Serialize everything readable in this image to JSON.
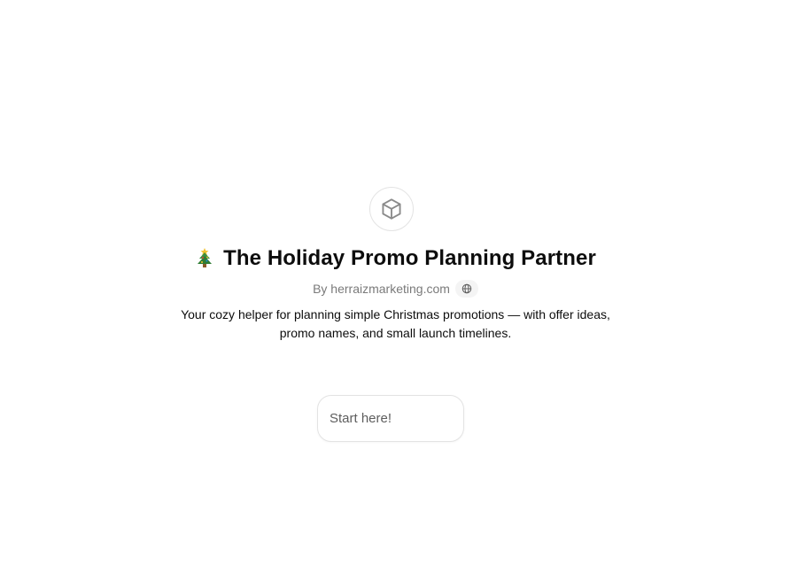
{
  "gpt": {
    "avatar_icon": "cube-icon",
    "title_emoji": "christmas-tree-icon",
    "title": "The Holiday Promo Planning Partner",
    "byline": "By herraizmarketing.com",
    "website_icon": "globe-icon",
    "description": "Your cozy helper for planning simple Christmas promotions — with offer ideas, promo names, and small launch timelines."
  },
  "conversation_starters": [
    {
      "label": "Start here!"
    }
  ],
  "colors": {
    "text": "#0d0d0d",
    "muted": "#7a7a7a",
    "border": "#e3e3e3",
    "tree_green": "#3e8e41",
    "tree_star": "#f2c230"
  }
}
